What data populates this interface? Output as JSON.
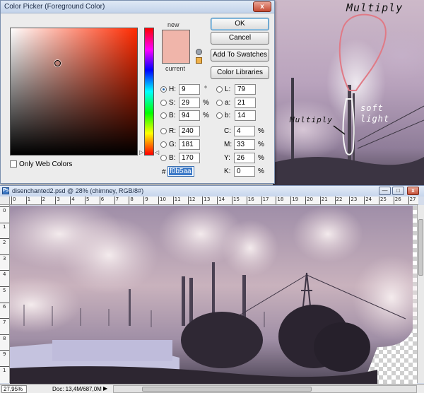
{
  "dialog": {
    "title": "Color Picker (Foreground Color)",
    "close_label": "x",
    "new_label": "new",
    "current_label": "current",
    "new_color": "#f0b5aa",
    "current_color": "#f0b5aa",
    "buttons": {
      "ok": "OK",
      "cancel": "Cancel",
      "add_swatches": "Add To Swatches",
      "color_libraries": "Color Libraries"
    },
    "fields": {
      "H": {
        "label": "H:",
        "value": "9",
        "unit": "°"
      },
      "S": {
        "label": "S:",
        "value": "29",
        "unit": "%"
      },
      "Bv": {
        "label": "B:",
        "value": "94",
        "unit": "%"
      },
      "R": {
        "label": "R:",
        "value": "240"
      },
      "G": {
        "label": "G:",
        "value": "181"
      },
      "Bl": {
        "label": "B:",
        "value": "170"
      },
      "L": {
        "label": "L:",
        "value": "79"
      },
      "a": {
        "label": "a:",
        "value": "21"
      },
      "b": {
        "label": "b:",
        "value": "14"
      },
      "C": {
        "label": "C:",
        "value": "4",
        "unit": "%"
      },
      "M": {
        "label": "M:",
        "value": "33",
        "unit": "%"
      },
      "Y": {
        "label": "Y:",
        "value": "26",
        "unit": "%"
      },
      "K": {
        "label": "K:",
        "value": "0",
        "unit": "%"
      }
    },
    "hex_label": "#",
    "hex_value": "f0b5aa",
    "only_web_colors": "Only Web Colors"
  },
  "annotations": {
    "multiply_top": "Multiply",
    "multiply_left": "Multiply",
    "soft_light": "soft light"
  },
  "document": {
    "title": "disenchanted2.psd @ 28% (chimney, RGB/8#)",
    "icon_letter": "Ps",
    "min_label": "—",
    "max_label": "□",
    "close_label": "x",
    "ruler_top": [
      "0",
      "1",
      "2",
      "3",
      "4",
      "5",
      "6",
      "7",
      "8",
      "9",
      "10",
      "11",
      "12",
      "13",
      "14",
      "15",
      "16",
      "17",
      "18",
      "19",
      "20",
      "21",
      "22",
      "23",
      "24",
      "25",
      "26",
      "27"
    ],
    "ruler_left": [
      "0",
      "1",
      "2",
      "3",
      "4",
      "5",
      "6",
      "7",
      "8",
      "9",
      "1"
    ],
    "zoom": "27,95%",
    "doc_info": "Doc: 13,4M/687,0M",
    "status_arrow": "▶"
  }
}
